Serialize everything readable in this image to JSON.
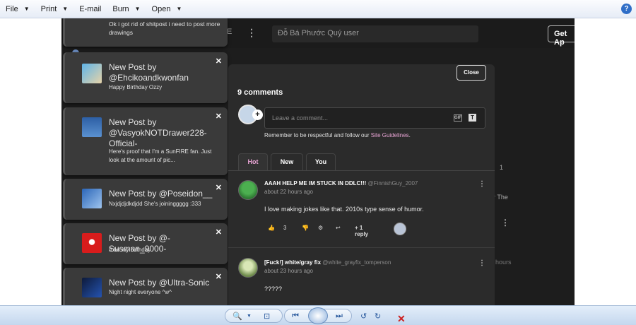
{
  "menubar": {
    "items": [
      {
        "label": "File"
      },
      {
        "label": "Print"
      },
      {
        "label": "E-mail"
      },
      {
        "label": "Burn"
      },
      {
        "label": "Open"
      }
    ],
    "help_icon": "help-icon",
    "help_label": "?"
  },
  "site": {
    "search_placeholder": "Đỗ Bá Phước Quý user",
    "get_app_label": "Get Ap",
    "header_letter": "E",
    "bg_text_1": "or The",
    "bg_text_2": "hours",
    "bg_count": "1"
  },
  "notifications": [
    {
      "title": "",
      "body": "Ok i got rid of shitpost i need to post more drawings"
    },
    {
      "title": "New Post by @Ehcikoandkwonfan",
      "body": "Happy Birthday Ozzy"
    },
    {
      "title": "New Post by @VasyokNOTDrawer228-Official-",
      "body": "Here's proof that I'm a SunFIRE fan. Just look at the amount of pic..."
    },
    {
      "title": "New Post by @Poseidon__",
      "body": "Nxjdjdjdkdjdd She's joininggggg :333"
    },
    {
      "title": "New Post by @-Susman_9000-",
      "body": "It be my birthday"
    },
    {
      "title": "New Post by @Ultra-Sonic",
      "body": "Night night everyone ^w^"
    }
  ],
  "modal": {
    "close_label": "Close",
    "comment_count": "9 comments",
    "comment_placeholder": "Leave a comment...",
    "gif_label": "GIF",
    "text_label": "T",
    "guidelines_text": "Remember to be respectful and follow our ",
    "guidelines_link": "Site Guidelines",
    "guidelines_end": ".",
    "tabs": [
      {
        "label": "Hot"
      },
      {
        "label": "New"
      },
      {
        "label": "You"
      }
    ],
    "comments": [
      {
        "name": "AAAH HELP ME IM STUCK IN DDLC!!!",
        "handle": "@FinnishGuy_2007",
        "time": "about 22 hours ago",
        "text": "I love making jokes like that. 2010s type sense of humor.",
        "likes": "3",
        "replies": "+ 1 reply"
      },
      {
        "name": "[Fuck!] white/gray fix",
        "handle": "@white_grayfix_tomperson",
        "time": "about 23 hours ago",
        "text": "?????"
      }
    ]
  },
  "colors": {
    "accent_pink": "#e8a4d4",
    "panel": "#2b2b2b",
    "notif": "#3a3a3a"
  }
}
